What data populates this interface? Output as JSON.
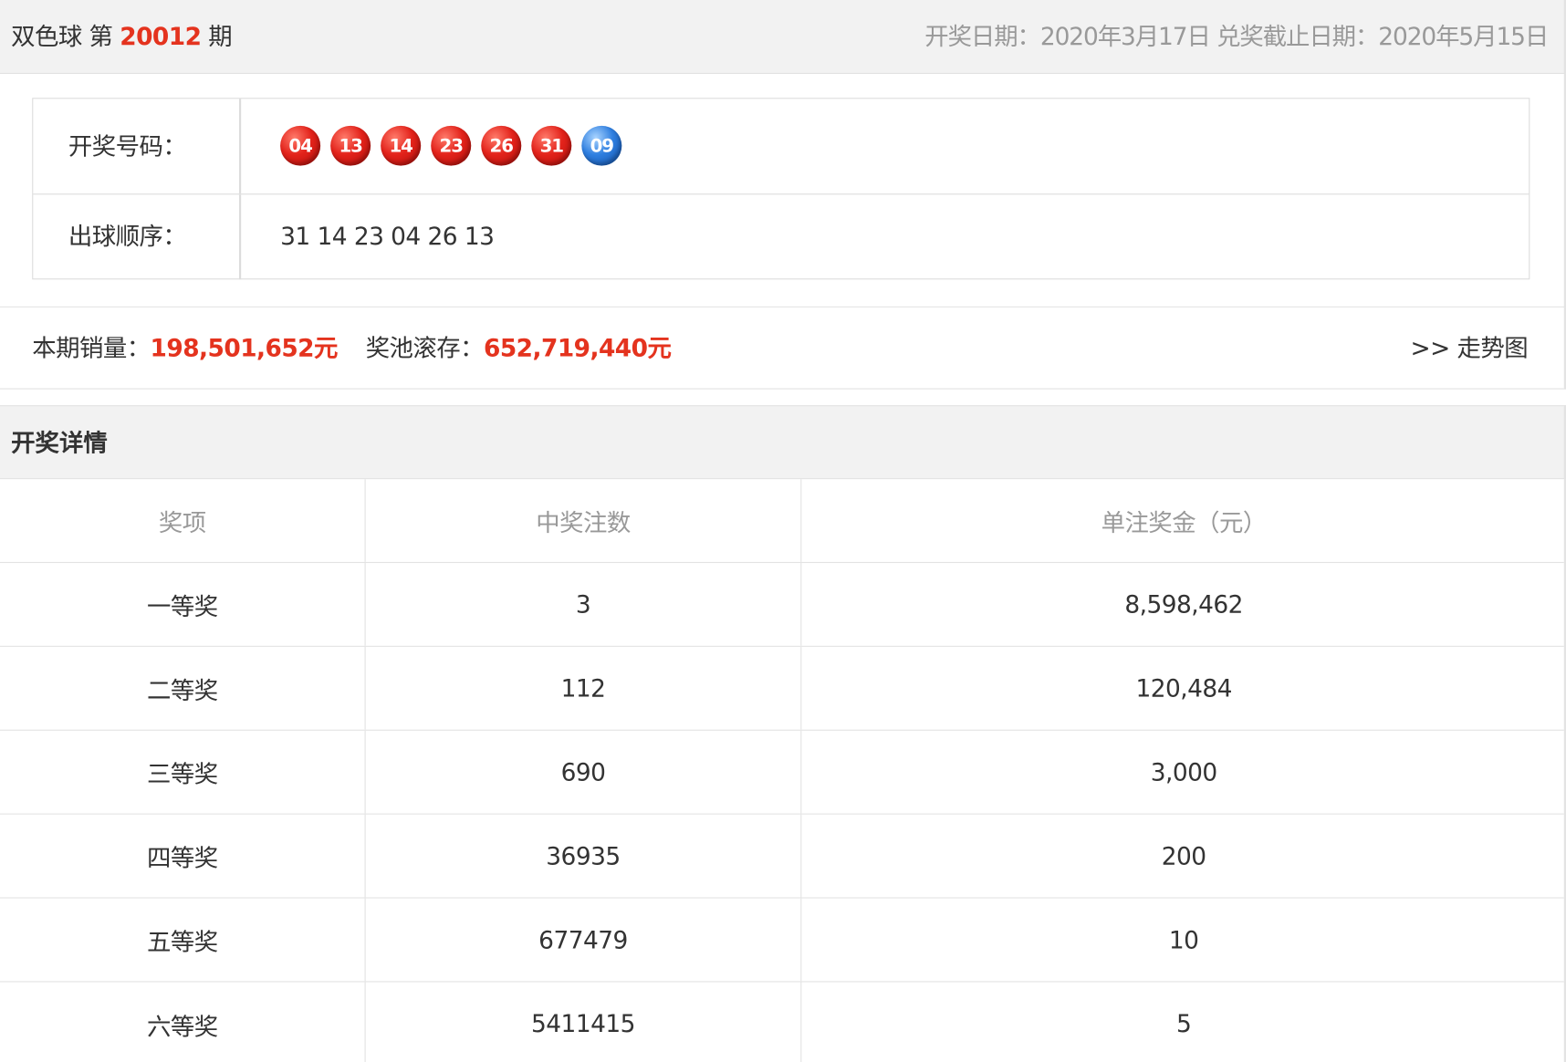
{
  "header": {
    "lottery_name": "双色球 第 ",
    "issue_number": "20012",
    "issue_suffix": " 期",
    "dates": "开奖日期：2020年3月17日 兑奖截止日期：2020年5月15日"
  },
  "draw": {
    "numbers_label": "开奖号码：",
    "red_balls": [
      "04",
      "13",
      "14",
      "23",
      "26",
      "31"
    ],
    "blue_ball": "09",
    "order_label": "出球顺序：",
    "order_value": "31 14 23 04 26 13"
  },
  "sales": {
    "sales_label": "本期销量：",
    "sales_value": "198,501,652元",
    "pool_label": "奖池滚存：",
    "pool_value": "652,719,440元",
    "trend_link": ">> 走势图"
  },
  "detail": {
    "title": "开奖详情",
    "columns": [
      "奖项",
      "中奖注数",
      "单注奖金（元）"
    ],
    "rows": [
      {
        "prize": "一等奖",
        "count": "3",
        "amount": "8,598,462"
      },
      {
        "prize": "二等奖",
        "count": "112",
        "amount": "120,484"
      },
      {
        "prize": "三等奖",
        "count": "690",
        "amount": "3,000"
      },
      {
        "prize": "四等奖",
        "count": "36935",
        "amount": "200"
      },
      {
        "prize": "五等奖",
        "count": "677479",
        "amount": "10"
      },
      {
        "prize": "六等奖",
        "count": "5411415",
        "amount": "5"
      }
    ]
  },
  "colors": {
    "accent_red": "#e4331e",
    "muted_text": "#999999",
    "header_bg": "#f2f2f2"
  }
}
